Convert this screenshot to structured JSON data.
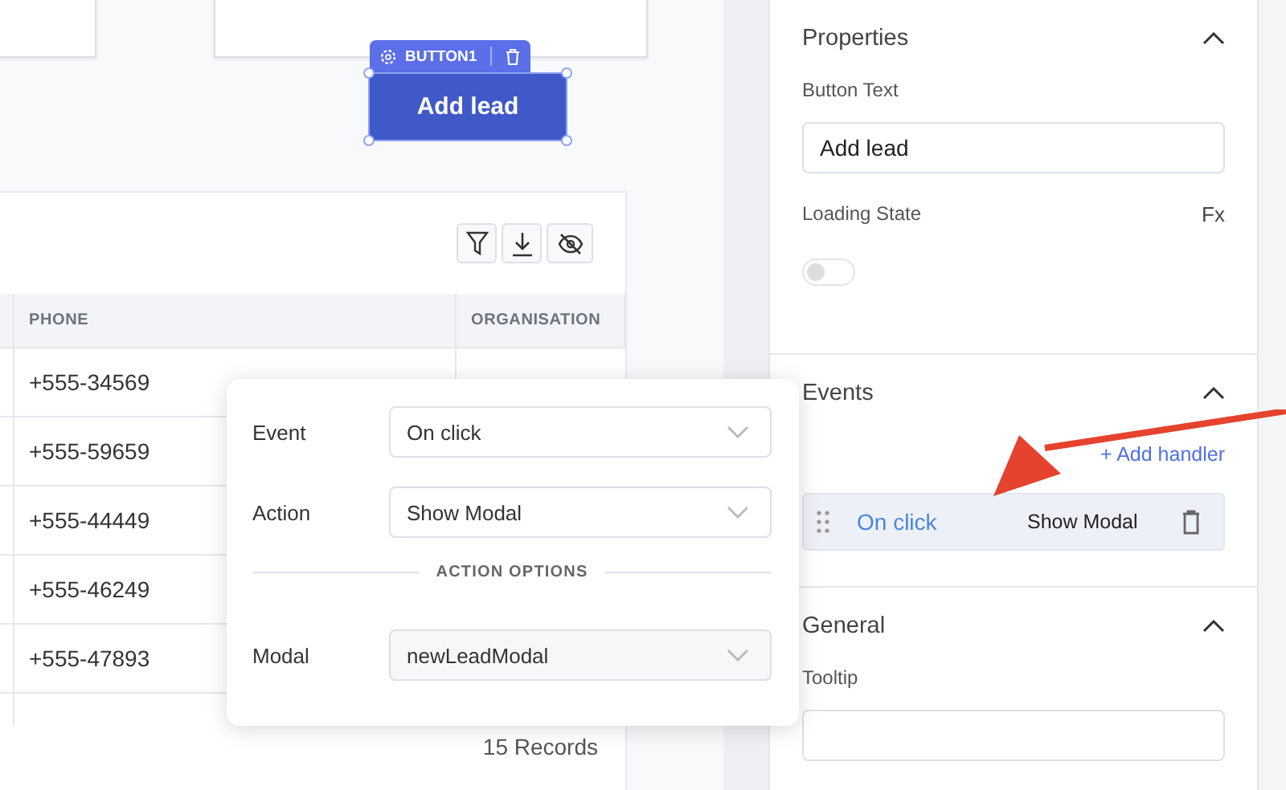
{
  "canvas": {
    "button": {
      "widget_label": "BUTTON1",
      "text": "Add lead",
      "selected": true
    }
  },
  "table": {
    "columns": [
      "PHONE",
      "ORGANISATION"
    ],
    "rows": [
      {
        "phone": "+555-34569"
      },
      {
        "phone": "+555-59659"
      },
      {
        "phone": "+555-44449"
      },
      {
        "phone": "+555-46249"
      },
      {
        "phone": "+555-47893"
      }
    ],
    "footer": "15 Records"
  },
  "popup": {
    "fields": [
      {
        "label": "Event",
        "value": "On click"
      },
      {
        "label": "Action",
        "value": "Show Modal"
      }
    ],
    "section": "ACTION OPTIONS",
    "options": [
      {
        "label": "Modal",
        "value": "newLeadModal"
      }
    ]
  },
  "panel": {
    "sections": [
      {
        "title": "Properties",
        "expanded": true,
        "items": [
          {
            "kind": "text",
            "label": "Button Text",
            "value": "Add lead"
          },
          {
            "kind": "toggle",
            "label": "Loading State",
            "fx": "Fx",
            "on": false
          }
        ]
      },
      {
        "title": "Events",
        "expanded": true,
        "add": "+ Add handler",
        "handlers": [
          {
            "event": "On click",
            "action": "Show Modal"
          }
        ]
      },
      {
        "title": "General",
        "expanded": true,
        "items": [
          {
            "kind": "text",
            "label": "Tooltip",
            "value": ""
          }
        ]
      }
    ]
  }
}
